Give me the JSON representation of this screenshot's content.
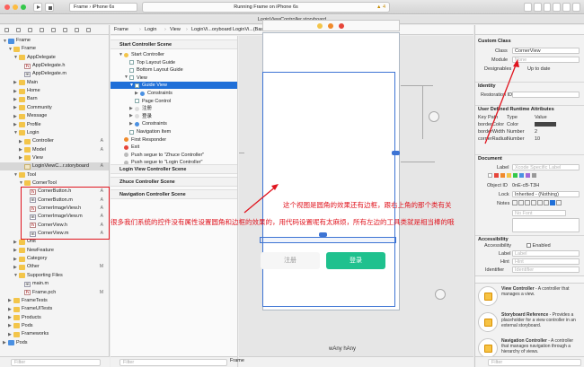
{
  "toolbar": {
    "scheme_target": "Frame",
    "scheme_device": "iPhone 6s",
    "activity": "Running Frame on iPhone 6s",
    "warning_count": "4"
  },
  "editor_title": "LoginViewController.storyboard",
  "jumpbar": [
    "Frame",
    "Login",
    "View",
    "LoginVi...oryboard",
    "LoginVi...(Base)",
    "Start C...r Scene",
    "Start Controller",
    "View",
    "Guide View"
  ],
  "navigator": {
    "rows": [
      {
        "label": "Frame",
        "indent": 0,
        "icon": "blueproj",
        "arrow": "open",
        "badge": ""
      },
      {
        "label": "Frame",
        "indent": 1,
        "icon": "folder",
        "arrow": "open",
        "badge": ""
      },
      {
        "label": "AppDelegate",
        "indent": 2,
        "icon": "folder",
        "arrow": "open",
        "badge": ""
      },
      {
        "label": "AppDelegate.h",
        "indent": 3,
        "icon": "h",
        "arrow": "",
        "badge": ""
      },
      {
        "label": "AppDelegate.m",
        "indent": 3,
        "icon": "m",
        "arrow": "",
        "badge": ""
      },
      {
        "label": "Main",
        "indent": 2,
        "icon": "folder",
        "arrow": "closed",
        "badge": ""
      },
      {
        "label": "Home",
        "indent": 2,
        "icon": "folder",
        "arrow": "closed",
        "badge": ""
      },
      {
        "label": "Barn",
        "indent": 2,
        "icon": "folder",
        "arrow": "closed",
        "badge": ""
      },
      {
        "label": "Community",
        "indent": 2,
        "icon": "folder",
        "arrow": "closed",
        "badge": ""
      },
      {
        "label": "Message",
        "indent": 2,
        "icon": "folder",
        "arrow": "closed",
        "badge": ""
      },
      {
        "label": "Profile",
        "indent": 2,
        "icon": "folder",
        "arrow": "closed",
        "badge": ""
      },
      {
        "label": "Login",
        "indent": 2,
        "icon": "folder",
        "arrow": "open",
        "badge": ""
      },
      {
        "label": "Controller",
        "indent": 3,
        "icon": "folder",
        "arrow": "closed",
        "badge": "A"
      },
      {
        "label": "Model",
        "indent": 3,
        "icon": "folder",
        "arrow": "closed",
        "badge": "A"
      },
      {
        "label": "View",
        "indent": 3,
        "icon": "folder",
        "arrow": "closed",
        "badge": ""
      },
      {
        "label": "LoginViewC...r.storyboard",
        "indent": 3,
        "icon": "sb",
        "arrow": "",
        "badge": "A",
        "selected": true
      },
      {
        "label": "Tool",
        "indent": 2,
        "icon": "folder",
        "arrow": "open",
        "badge": ""
      },
      {
        "label": "CornerTool",
        "indent": 3,
        "icon": "folder",
        "arrow": "open",
        "badge": ""
      },
      {
        "label": "CornerButton.h",
        "indent": 4,
        "icon": "h",
        "arrow": "",
        "badge": "A"
      },
      {
        "label": "CornerButton.m",
        "indent": 4,
        "icon": "m",
        "arrow": "",
        "badge": "A"
      },
      {
        "label": "CornerImageView.h",
        "indent": 4,
        "icon": "h",
        "arrow": "",
        "badge": "A"
      },
      {
        "label": "CornerImageView.m",
        "indent": 4,
        "icon": "m",
        "arrow": "",
        "badge": "A"
      },
      {
        "label": "CornerView.h",
        "indent": 4,
        "icon": "h",
        "arrow": "",
        "badge": "A"
      },
      {
        "label": "CornerView.m",
        "indent": 4,
        "icon": "m",
        "arrow": "",
        "badge": "A"
      },
      {
        "label": "Unit",
        "indent": 2,
        "icon": "folder",
        "arrow": "closed",
        "badge": ""
      },
      {
        "label": "NewFeature",
        "indent": 2,
        "icon": "folder",
        "arrow": "closed",
        "badge": ""
      },
      {
        "label": "Category",
        "indent": 2,
        "icon": "folder",
        "arrow": "closed",
        "badge": ""
      },
      {
        "label": "Other",
        "indent": 2,
        "icon": "folder",
        "arrow": "closed",
        "badge": "M"
      },
      {
        "label": "Supporting Files",
        "indent": 2,
        "icon": "folder",
        "arrow": "open",
        "badge": ""
      },
      {
        "label": "main.m",
        "indent": 3,
        "icon": "m",
        "arrow": "",
        "badge": ""
      },
      {
        "label": "Frame.pch",
        "indent": 3,
        "icon": "h",
        "arrow": "",
        "badge": "M"
      },
      {
        "label": "FrameTests",
        "indent": 1,
        "icon": "folder",
        "arrow": "closed",
        "badge": ""
      },
      {
        "label": "FrameUITests",
        "indent": 1,
        "icon": "folder",
        "arrow": "closed",
        "badge": ""
      },
      {
        "label": "Products",
        "indent": 1,
        "icon": "folder",
        "arrow": "closed",
        "badge": ""
      },
      {
        "label": "Pods",
        "indent": 1,
        "icon": "folder",
        "arrow": "closed",
        "badge": ""
      },
      {
        "label": "Frameworks",
        "indent": 1,
        "icon": "folder",
        "arrow": "closed",
        "badge": ""
      },
      {
        "label": "Pods",
        "indent": 0,
        "icon": "blueproj",
        "arrow": "closed",
        "badge": ""
      }
    ],
    "filter_placeholder": "Filter"
  },
  "outline": {
    "scene1": "Start Controller Scene",
    "items": [
      {
        "label": "Start Controller",
        "indent": 1,
        "kind": "yellow",
        "arrow": "open"
      },
      {
        "label": "Top Layout Guide",
        "indent": 2,
        "kind": "sq",
        "arrow": ""
      },
      {
        "label": "Bottom Layout Guide",
        "indent": 2,
        "kind": "sq",
        "arrow": ""
      },
      {
        "label": "View",
        "indent": 2,
        "kind": "sq",
        "arrow": "open"
      },
      {
        "label": "Guide View",
        "indent": 3,
        "kind": "sq",
        "arrow": "open",
        "selected": true
      },
      {
        "label": "Constraints",
        "indent": 4,
        "kind": "blue",
        "arrow": "closed"
      },
      {
        "label": "Page Control",
        "indent": 3,
        "kind": "sq",
        "arrow": ""
      },
      {
        "label": "注册",
        "indent": 3,
        "kind": "btn",
        "arrow": "closed"
      },
      {
        "label": "登录",
        "indent": 3,
        "kind": "btn",
        "arrow": "closed"
      },
      {
        "label": "Constraints",
        "indent": 3,
        "kind": "blue",
        "arrow": "closed"
      },
      {
        "label": "Navigation Item",
        "indent": 2,
        "kind": "sq",
        "arrow": ""
      },
      {
        "label": "First Responder",
        "indent": 1,
        "kind": "orange",
        "arrow": ""
      },
      {
        "label": "Exit",
        "indent": 1,
        "kind": "red",
        "arrow": ""
      },
      {
        "label": "Push segue to \"Zhuce Controller\"",
        "indent": 1,
        "kind": "segue",
        "arrow": ""
      },
      {
        "label": "Push segue to \"Login Controller\"",
        "indent": 1,
        "kind": "segue",
        "arrow": ""
      }
    ],
    "scenes": [
      "Login View Controller Scene",
      "Zhuce Controller Scene",
      "Navigation Controller Scene"
    ],
    "filter_placeholder": "Filter"
  },
  "canvas": {
    "register_label": "注册",
    "login_label": "登录",
    "size_class": "wAny hAny"
  },
  "annotations": {
    "top": "这个视图是圆角的效果还有边框，跟右上角的那个类有关",
    "bottom": "很多我们系统的控件没有属性设置圆角和边框的效果的，用代码设置呢有太麻烦，所有左边的工具类就是相当棒的哦"
  },
  "inspector": {
    "custom_class_title": "Custom Class",
    "class_label": "Class",
    "class_value": "CornerView",
    "module_label": "Module",
    "module_value": "None",
    "designables_label": "Designables",
    "designables_value": "Up to date",
    "identity_title": "Identity",
    "restoration_label": "Restoration ID",
    "udra_title": "User Defined Runtime Attributes",
    "udra_headers": [
      "Key Path",
      "Type",
      "Value"
    ],
    "udra_rows": [
      {
        "key": "borderColor",
        "type": "Color",
        "value": ""
      },
      {
        "key": "borderWidth",
        "type": "Number",
        "value": "2"
      },
      {
        "key": "cornerRadius",
        "type": "Number",
        "value": "10"
      }
    ],
    "document_title": "Document",
    "label_label": "Label",
    "label_placeholder": "Xcode Specific Label",
    "object_id_label": "Object ID",
    "object_id_value": "0nE-cB-T3H",
    "lock_label": "Lock",
    "lock_value": "Inherited - (Nothing)",
    "notes_label": "Notes",
    "notes_placeholder": "No Font",
    "accessibility_title": "Accessibility",
    "accessibility_label": "Accessibility",
    "accessibility_enabled": "Enabled",
    "acc_label": "Label",
    "acc_label_placeholder": "Label",
    "hint_label": "Hint",
    "hint_placeholder": "Hint",
    "identifier_label": "Identifier",
    "identifier_placeholder": "Identifier",
    "library": [
      {
        "title": "View Controller",
        "desc": " - A controller that manages a view."
      },
      {
        "title": "Storyboard Reference",
        "desc": " - Provides a placeholder for a view controller in an external storyboard."
      },
      {
        "title": "Navigation Controller",
        "desc": " - A controller that manages navigation through a hierarchy of views."
      }
    ],
    "filter_placeholder": "Filter"
  },
  "bottom_bar": {
    "target": "Frame"
  },
  "colors": {
    "accent": "#1f6fd8",
    "login_green": "#1fc18e",
    "annotation_red": "#e0141e"
  }
}
